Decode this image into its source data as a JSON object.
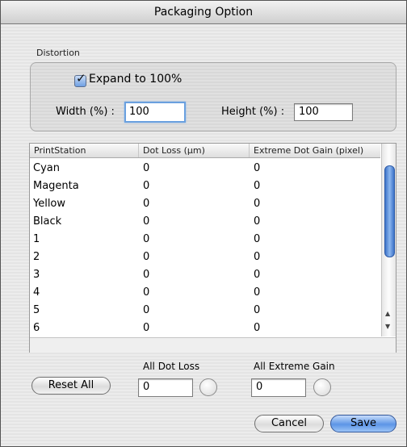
{
  "window": {
    "title": "Packaging Option"
  },
  "distortion": {
    "section_label": "Distortion",
    "expand_label": "Expand to 100%",
    "expand_checked": true,
    "width_label": "Width (%) :",
    "width_value": "100",
    "height_label": "Height (%) :",
    "height_value": "100"
  },
  "table": {
    "columns": [
      "PrintStation",
      "Dot Loss (µm)",
      "Extreme Dot Gain (pixel)"
    ],
    "rows": [
      [
        "Cyan",
        "0",
        "0"
      ],
      [
        "Magenta",
        "0",
        "0"
      ],
      [
        "Yellow",
        "0",
        "0"
      ],
      [
        "Black",
        "0",
        "0"
      ],
      [
        "1",
        "0",
        "0"
      ],
      [
        "2",
        "0",
        "0"
      ],
      [
        "3",
        "0",
        "0"
      ],
      [
        "4",
        "0",
        "0"
      ],
      [
        "5",
        "0",
        "0"
      ],
      [
        "6",
        "0",
        "0"
      ]
    ]
  },
  "bulk": {
    "reset_label": "Reset All",
    "dot_loss_label": "All Dot Loss",
    "dot_loss_value": "0",
    "extreme_gain_label": "All Extreme Gain",
    "extreme_gain_value": "0"
  },
  "footer": {
    "cancel_label": "Cancel",
    "save_label": "Save"
  },
  "colors": {
    "accent": "#5d95e6",
    "scroll_thumb": "#3d73c9"
  }
}
